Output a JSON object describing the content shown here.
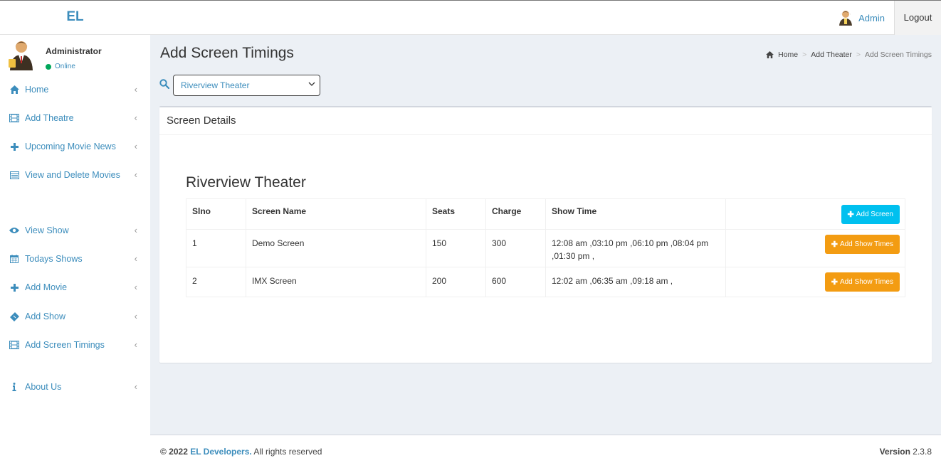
{
  "app": {
    "logo": "EL",
    "user_name": "Admin",
    "logout_label": "Logout"
  },
  "sidebar": {
    "user": {
      "name": "Administrator",
      "status": "Online"
    },
    "items": [
      {
        "label": "Home",
        "icon": "home-icon"
      },
      {
        "label": "Add Theatre",
        "icon": "film-icon"
      },
      {
        "label": "Upcoming Movie News",
        "icon": "plus-icon"
      },
      {
        "label": "View and Delete Movies",
        "icon": "list-icon"
      },
      {
        "label": "View Show",
        "icon": "eye-icon"
      },
      {
        "label": "Todays Shows",
        "icon": "calendar-icon"
      },
      {
        "label": "Add Movie",
        "icon": "plus-icon"
      },
      {
        "label": "Add Show",
        "icon": "ticket-icon"
      },
      {
        "label": "Add Screen Timings",
        "icon": "film-icon"
      },
      {
        "label": "About Us",
        "icon": "info-icon"
      }
    ]
  },
  "page": {
    "title": "Add Screen Timings",
    "breadcrumb": [
      "Home",
      "Add Theater",
      "Add Screen Timings"
    ]
  },
  "search": {
    "selected_theater": "Riverview Theater"
  },
  "box": {
    "title": "Screen Details",
    "theater_name": "Riverview Theater",
    "columns": [
      "Slno",
      "Screen Name",
      "Seats",
      "Charge",
      "Show Time"
    ],
    "add_screen_label": "Add Screen",
    "add_show_times_label": "Add Show Times",
    "rows": [
      {
        "slno": "1",
        "screen_name": "Demo Screen",
        "seats": "150",
        "charge": "300",
        "show_time": "12:08 am ,03:10 pm ,06:10 pm ,08:04 pm ,01:30 pm ,"
      },
      {
        "slno": "2",
        "screen_name": "IMX Screen",
        "seats": "200",
        "charge": "600",
        "show_time": "12:02 am ,06:35 am ,09:18 am ,"
      }
    ]
  },
  "footer": {
    "copyright": "© 2022",
    "brand": "EL Developers.",
    "rights": "All rights reserved",
    "version_label": "Version",
    "version": "2.3.8"
  },
  "colors": {
    "accent": "#3c8dbc",
    "info_button": "#00c0ef",
    "warning_button": "#f39c12",
    "online": "#00a65a",
    "background": "#ecf0f5"
  }
}
